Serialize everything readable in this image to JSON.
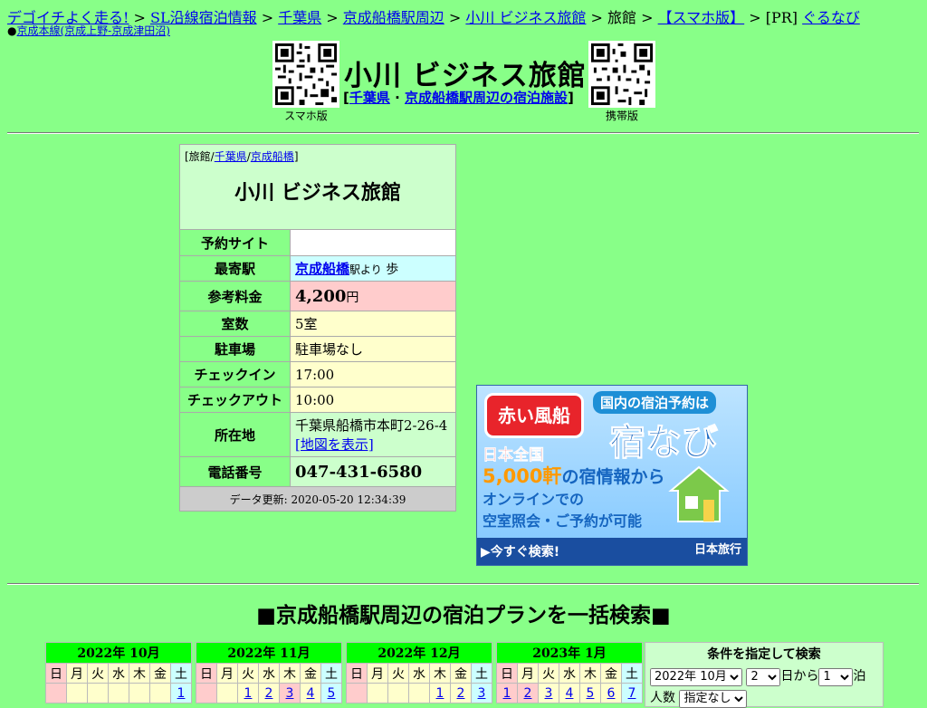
{
  "breadcrumb": {
    "home": "デゴイチよく走る!",
    "sep1": " > ",
    "sl": "SL沿線宿泊情報",
    "sep2": " > ",
    "pref": "千葉県",
    "sep3": " > ",
    "area": "京成船橋駅周辺",
    "sep4": " > ",
    "hotel": "小川 ビジネス旅館",
    "sep5": " > ",
    "type": "旅館",
    "sep6": " > ",
    "smart": "【スマホ版】",
    "sep7": " > [PR] ",
    "pr": "ぐるなび"
  },
  "line": {
    "bullet": "●",
    "link": "京成本線(京成上野-京成津田沼)"
  },
  "header": {
    "title": "小川 ビジネス旅館",
    "sub_open": "[",
    "sub_pref": "千葉県",
    "sub_dot": " · ",
    "sub_area": "京成船橋駅周辺の宿泊施設",
    "sub_close": "]",
    "qr_left_caption": "スマホ版",
    "qr_right_caption": "携帯版"
  },
  "info": {
    "cat_open": "[旅館/",
    "cat_pref": "千葉県",
    "cat_slash": "/",
    "cat_station": "京成船橋",
    "cat_close": "]",
    "name": "小川 ビジネス旅館",
    "rows": {
      "reserve_label": "予約サイト",
      "reserve_value": "",
      "station_label": "最寄駅",
      "station_link": "京成船橋",
      "station_suffix": "駅より",
      "station_walk": " 歩",
      "price_label": "参考料金",
      "price_value": "4,200",
      "price_unit": "円",
      "rooms_label": "室数",
      "rooms_value": "5室",
      "parking_label": "駐車場",
      "parking_value": "駐車場なし",
      "checkin_label": "チェックイン",
      "checkin_value": "17:00",
      "checkout_label": "チェックアウト",
      "checkout_value": "10:00",
      "address_label": "所在地",
      "address_value": "千葉県船橋市本町2-26-4",
      "map_link": "[地図を表示]",
      "phone_label": "電話番号",
      "phone_value": "047-431-6580"
    },
    "updated": "データ更新: 2020-05-20 12:34:39"
  },
  "ad": {
    "brand": "赤い風船",
    "tag": "国内の宿泊予約は",
    "service": "宿なび",
    "line1": "日本全国",
    "line2_num": "5,000軒",
    "line2_rest": "の宿情報から",
    "line3": "オンラインでの",
    "line4": "空室照会・ご予約が可能",
    "cta": "▶今すぐ検索!",
    "company": "日本旅行",
    "colors": {
      "balloon": "#e8242b",
      "primary": "#1565c0",
      "accent": "#ff9900"
    }
  },
  "search": {
    "heading": "■京成船橋駅周辺の宿泊プランを一括検索■",
    "weekdays": [
      "日",
      "月",
      "火",
      "水",
      "木",
      "金",
      "土"
    ],
    "calendars": [
      {
        "month": "2022年 10月",
        "days": [
          "",
          "",
          "",
          "",
          "",
          "",
          "1"
        ]
      },
      {
        "month": "2022年 11月",
        "days": [
          "",
          "",
          "1",
          "2",
          "3",
          "4",
          "5"
        ]
      },
      {
        "month": "2022年 12月",
        "days": [
          "",
          "",
          "",
          "",
          "1",
          "2",
          "3"
        ]
      },
      {
        "month": "2023年 1月",
        "days": [
          "1",
          "2",
          "3",
          "4",
          "5",
          "6",
          "7"
        ]
      }
    ],
    "cond": {
      "heading": "条件を指定して検索",
      "month_value": "2022年 10月",
      "day_value": "2",
      "from_label": "日から",
      "nights_value": "1",
      "nights_label": "泊",
      "people_label": "人数",
      "people_value": "指定なし"
    }
  }
}
